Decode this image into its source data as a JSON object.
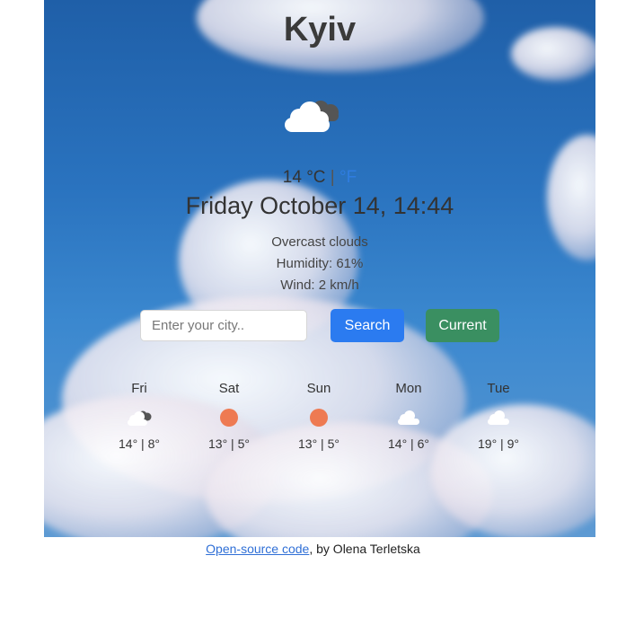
{
  "city": "Kyiv",
  "current": {
    "temperature": "14",
    "unit_c": "°C",
    "separator": "|",
    "unit_f": "°F",
    "date": "Friday October 14, 14:44",
    "description": "Overcast clouds",
    "humidity": "Humidity: 61%",
    "wind": "Wind: 2 km/h",
    "icon": "broken-clouds-icon"
  },
  "search": {
    "placeholder": "Enter your city..",
    "value": "",
    "search_label": "Search",
    "current_label": "Current"
  },
  "forecast": [
    {
      "day": "Fri",
      "temps": "14° | 8°",
      "icon": "broken-clouds-icon"
    },
    {
      "day": "Sat",
      "temps": "13° | 5°",
      "icon": "sun-icon"
    },
    {
      "day": "Sun",
      "temps": "13° | 5°",
      "icon": "sun-icon"
    },
    {
      "day": "Mon",
      "temps": "14° | 6°",
      "icon": "cloud-icon"
    },
    {
      "day": "Tue",
      "temps": "19° | 9°",
      "icon": "cloud-icon"
    }
  ],
  "footer": {
    "link_text": "Open-source code",
    "suffix": ", by Olena Terletska"
  },
  "colors": {
    "search_button": "#2b7bf0",
    "current_button": "#3a8f61",
    "fahrenheit_link": "#2f7de1",
    "sun": "#ee7a52"
  }
}
